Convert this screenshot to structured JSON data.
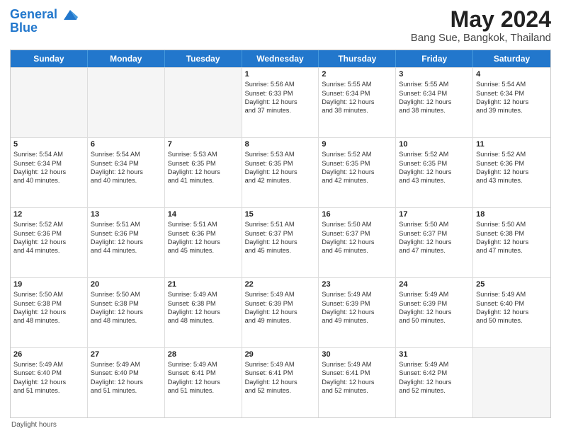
{
  "header": {
    "logo_line1": "General",
    "logo_line2": "Blue",
    "title": "May 2024",
    "subtitle": "Bang Sue, Bangkok, Thailand"
  },
  "calendar": {
    "days_of_week": [
      "Sunday",
      "Monday",
      "Tuesday",
      "Wednesday",
      "Thursday",
      "Friday",
      "Saturday"
    ],
    "weeks": [
      [
        {
          "day": "",
          "info": "",
          "empty": true
        },
        {
          "day": "",
          "info": "",
          "empty": true
        },
        {
          "day": "",
          "info": "",
          "empty": true
        },
        {
          "day": "1",
          "info": "Sunrise: 5:56 AM\nSunset: 6:33 PM\nDaylight: 12 hours\nand 37 minutes.",
          "empty": false
        },
        {
          "day": "2",
          "info": "Sunrise: 5:55 AM\nSunset: 6:34 PM\nDaylight: 12 hours\nand 38 minutes.",
          "empty": false
        },
        {
          "day": "3",
          "info": "Sunrise: 5:55 AM\nSunset: 6:34 PM\nDaylight: 12 hours\nand 38 minutes.",
          "empty": false
        },
        {
          "day": "4",
          "info": "Sunrise: 5:54 AM\nSunset: 6:34 PM\nDaylight: 12 hours\nand 39 minutes.",
          "empty": false
        }
      ],
      [
        {
          "day": "5",
          "info": "Sunrise: 5:54 AM\nSunset: 6:34 PM\nDaylight: 12 hours\nand 40 minutes.",
          "empty": false
        },
        {
          "day": "6",
          "info": "Sunrise: 5:54 AM\nSunset: 6:34 PM\nDaylight: 12 hours\nand 40 minutes.",
          "empty": false
        },
        {
          "day": "7",
          "info": "Sunrise: 5:53 AM\nSunset: 6:35 PM\nDaylight: 12 hours\nand 41 minutes.",
          "empty": false
        },
        {
          "day": "8",
          "info": "Sunrise: 5:53 AM\nSunset: 6:35 PM\nDaylight: 12 hours\nand 42 minutes.",
          "empty": false
        },
        {
          "day": "9",
          "info": "Sunrise: 5:52 AM\nSunset: 6:35 PM\nDaylight: 12 hours\nand 42 minutes.",
          "empty": false
        },
        {
          "day": "10",
          "info": "Sunrise: 5:52 AM\nSunset: 6:35 PM\nDaylight: 12 hours\nand 43 minutes.",
          "empty": false
        },
        {
          "day": "11",
          "info": "Sunrise: 5:52 AM\nSunset: 6:36 PM\nDaylight: 12 hours\nand 43 minutes.",
          "empty": false
        }
      ],
      [
        {
          "day": "12",
          "info": "Sunrise: 5:52 AM\nSunset: 6:36 PM\nDaylight: 12 hours\nand 44 minutes.",
          "empty": false
        },
        {
          "day": "13",
          "info": "Sunrise: 5:51 AM\nSunset: 6:36 PM\nDaylight: 12 hours\nand 44 minutes.",
          "empty": false
        },
        {
          "day": "14",
          "info": "Sunrise: 5:51 AM\nSunset: 6:36 PM\nDaylight: 12 hours\nand 45 minutes.",
          "empty": false
        },
        {
          "day": "15",
          "info": "Sunrise: 5:51 AM\nSunset: 6:37 PM\nDaylight: 12 hours\nand 45 minutes.",
          "empty": false
        },
        {
          "day": "16",
          "info": "Sunrise: 5:50 AM\nSunset: 6:37 PM\nDaylight: 12 hours\nand 46 minutes.",
          "empty": false
        },
        {
          "day": "17",
          "info": "Sunrise: 5:50 AM\nSunset: 6:37 PM\nDaylight: 12 hours\nand 47 minutes.",
          "empty": false
        },
        {
          "day": "18",
          "info": "Sunrise: 5:50 AM\nSunset: 6:38 PM\nDaylight: 12 hours\nand 47 minutes.",
          "empty": false
        }
      ],
      [
        {
          "day": "19",
          "info": "Sunrise: 5:50 AM\nSunset: 6:38 PM\nDaylight: 12 hours\nand 48 minutes.",
          "empty": false
        },
        {
          "day": "20",
          "info": "Sunrise: 5:50 AM\nSunset: 6:38 PM\nDaylight: 12 hours\nand 48 minutes.",
          "empty": false
        },
        {
          "day": "21",
          "info": "Sunrise: 5:49 AM\nSunset: 6:38 PM\nDaylight: 12 hours\nand 48 minutes.",
          "empty": false
        },
        {
          "day": "22",
          "info": "Sunrise: 5:49 AM\nSunset: 6:39 PM\nDaylight: 12 hours\nand 49 minutes.",
          "empty": false
        },
        {
          "day": "23",
          "info": "Sunrise: 5:49 AM\nSunset: 6:39 PM\nDaylight: 12 hours\nand 49 minutes.",
          "empty": false
        },
        {
          "day": "24",
          "info": "Sunrise: 5:49 AM\nSunset: 6:39 PM\nDaylight: 12 hours\nand 50 minutes.",
          "empty": false
        },
        {
          "day": "25",
          "info": "Sunrise: 5:49 AM\nSunset: 6:40 PM\nDaylight: 12 hours\nand 50 minutes.",
          "empty": false
        }
      ],
      [
        {
          "day": "26",
          "info": "Sunrise: 5:49 AM\nSunset: 6:40 PM\nDaylight: 12 hours\nand 51 minutes.",
          "empty": false
        },
        {
          "day": "27",
          "info": "Sunrise: 5:49 AM\nSunset: 6:40 PM\nDaylight: 12 hours\nand 51 minutes.",
          "empty": false
        },
        {
          "day": "28",
          "info": "Sunrise: 5:49 AM\nSunset: 6:41 PM\nDaylight: 12 hours\nand 51 minutes.",
          "empty": false
        },
        {
          "day": "29",
          "info": "Sunrise: 5:49 AM\nSunset: 6:41 PM\nDaylight: 12 hours\nand 52 minutes.",
          "empty": false
        },
        {
          "day": "30",
          "info": "Sunrise: 5:49 AM\nSunset: 6:41 PM\nDaylight: 12 hours\nand 52 minutes.",
          "empty": false
        },
        {
          "day": "31",
          "info": "Sunrise: 5:49 AM\nSunset: 6:42 PM\nDaylight: 12 hours\nand 52 minutes.",
          "empty": false
        },
        {
          "day": "",
          "info": "",
          "empty": true
        }
      ]
    ]
  },
  "footer": {
    "note": "Daylight hours"
  }
}
